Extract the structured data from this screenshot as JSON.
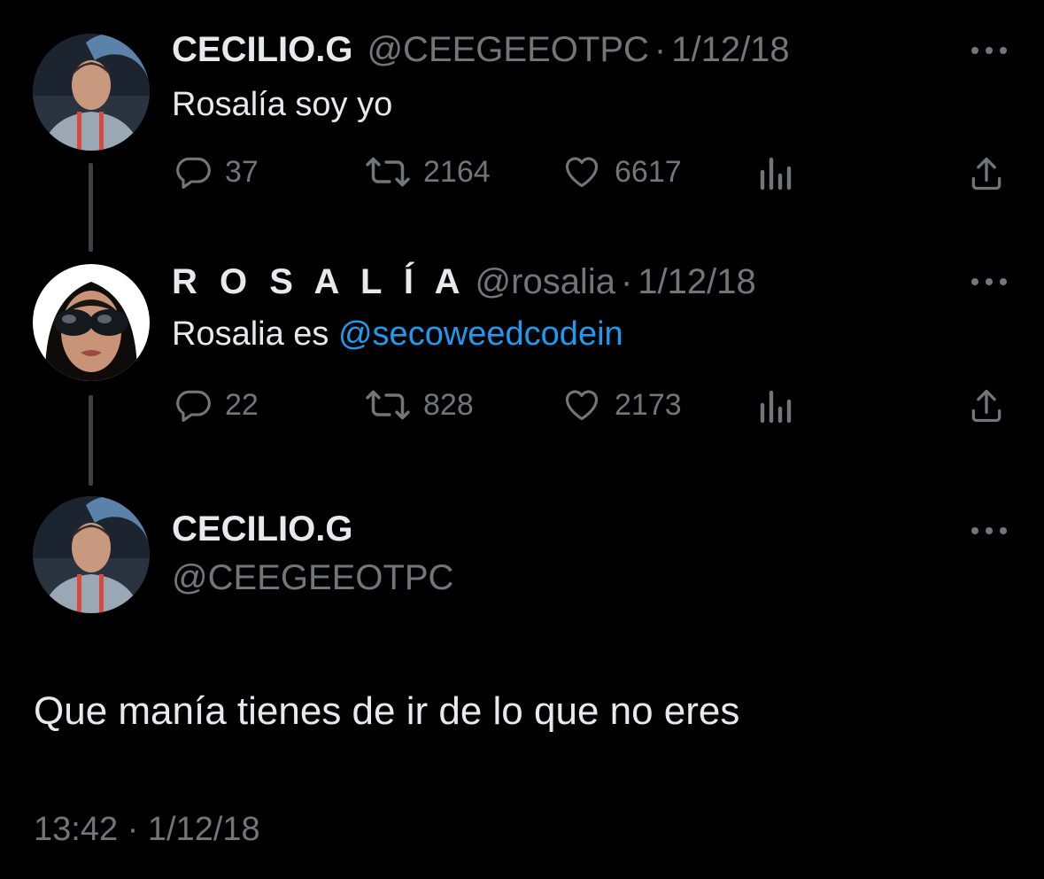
{
  "tweets": [
    {
      "display_name": "CECILIO.G",
      "handle": "@CEEGEEOTPC",
      "date": "1/12/18",
      "text": "Rosalía soy yo",
      "replies": "37",
      "retweets": "2164",
      "likes": "6617"
    },
    {
      "display_name": "R O S A L Í A",
      "handle": "@rosalia",
      "date": "1/12/18",
      "text_prefix": "Rosalia es ",
      "mention": "@secoweedcodein",
      "replies": "22",
      "retweets": "828",
      "likes": "2173"
    }
  ],
  "focused_tweet": {
    "display_name": "CECILIO.G",
    "handle": "@CEEGEEOTPC",
    "text": "Que manía tienes de ir de lo que no eres",
    "time": "13:42",
    "date": "1/12/18"
  },
  "separator": "·",
  "icons": {
    "reply": "reply-icon",
    "retweet": "retweet-icon",
    "like": "heart-icon",
    "views": "views-icon",
    "share": "share-icon",
    "more": "more-icon"
  },
  "colors": {
    "background": "#000000",
    "text": "#e7e9ea",
    "secondary": "#71767b",
    "link": "#1d9bf0"
  }
}
